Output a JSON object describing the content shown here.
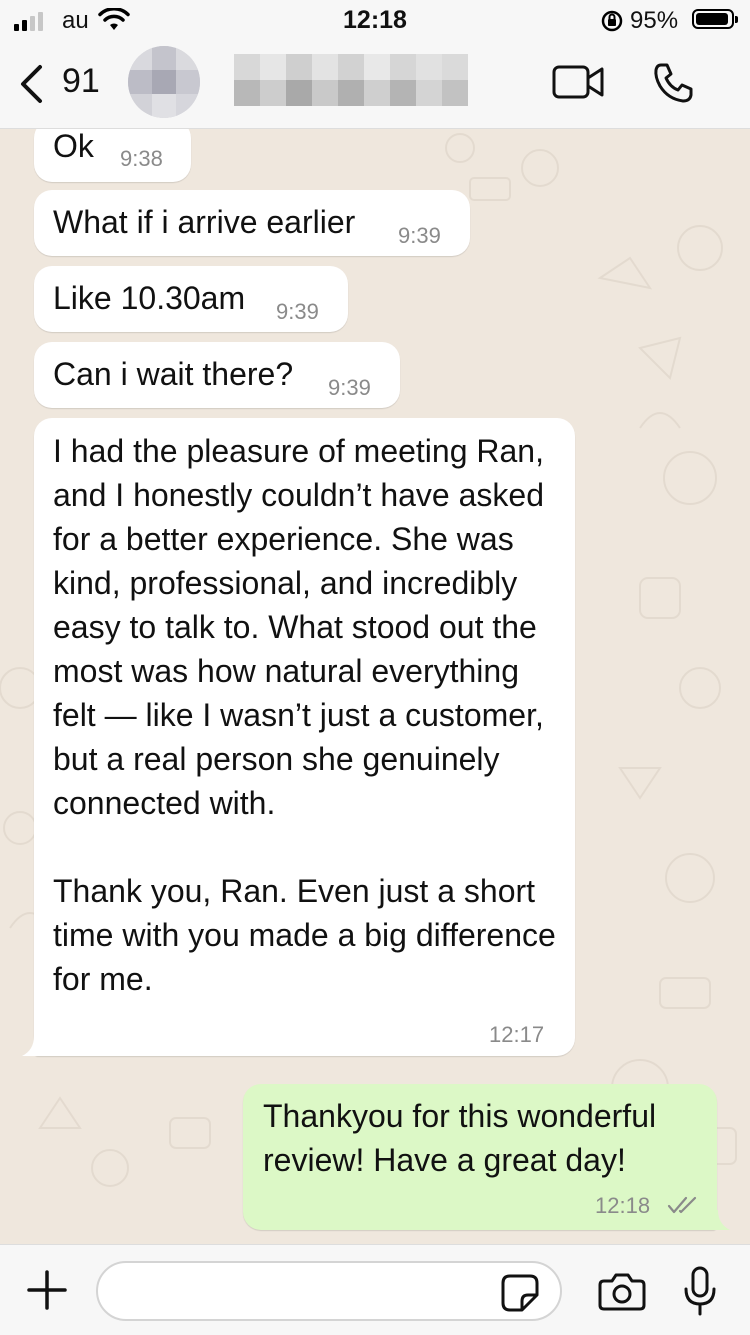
{
  "status_bar": {
    "carrier": "au",
    "time": "12:18",
    "battery_percent": "95%",
    "battery_level": 0.95
  },
  "header": {
    "contact_prefix": "91",
    "icons": [
      "back-chevron-icon",
      "video-call-icon",
      "phone-call-icon"
    ]
  },
  "messages": [
    {
      "direction": "incoming",
      "text": "Ok",
      "time": "9:38"
    },
    {
      "direction": "incoming",
      "text": "What if i arrive earlier",
      "time": "9:39"
    },
    {
      "direction": "incoming",
      "text": "Like 10.30am",
      "time": "9:39"
    },
    {
      "direction": "incoming",
      "text": "Can i wait there?",
      "time": "9:39"
    },
    {
      "direction": "incoming",
      "text": "I had the pleasure of meeting Ran, and I honestly couldn’t have asked for a better experience. She was kind, professional, and incredibly easy to talk to. What stood out the most was how natural everything felt — like I wasn’t just a customer, but a real person she genuinely connected with.\n\nThank you, Ran. Even just a short time with you made a big difference for me.",
      "time": "12:17"
    },
    {
      "direction": "outgoing",
      "text": "Thankyou for this wonderful review! Have a great day!",
      "time": "12:18",
      "status": "read-double-check"
    }
  ],
  "input_bar": {
    "placeholder": "",
    "icons": [
      "plus-icon",
      "sticker-icon",
      "camera-icon",
      "microphone-icon"
    ]
  },
  "colors": {
    "chat_background": "#efe7dd",
    "incoming_bubble": "#ffffff",
    "outgoing_bubble": "#dcf8c6",
    "read_tick": "#8a8a8a"
  }
}
